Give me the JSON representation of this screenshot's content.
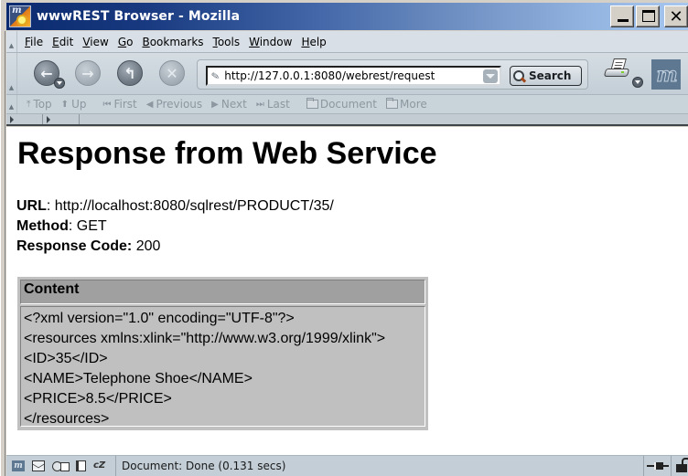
{
  "window": {
    "title": "wwwREST Browser - Mozilla",
    "controls": {
      "minimize": "minimize",
      "maximize": "maximize",
      "close": "close"
    }
  },
  "menubar": {
    "items": [
      {
        "label": "File",
        "accel": "F"
      },
      {
        "label": "Edit",
        "accel": "E"
      },
      {
        "label": "View",
        "accel": "V"
      },
      {
        "label": "Go",
        "accel": "G"
      },
      {
        "label": "Bookmarks",
        "accel": "B"
      },
      {
        "label": "Tools",
        "accel": "T"
      },
      {
        "label": "Window",
        "accel": "W"
      },
      {
        "label": "Help",
        "accel": "H"
      }
    ]
  },
  "navbar": {
    "back_icon": "back-arrow-icon",
    "forward_icon": "forward-arrow-icon",
    "reload_icon": "reload-icon",
    "stop_icon": "stop-icon",
    "url": "http://127.0.0.1:8080/webrest/request",
    "search_label": "Search",
    "print_icon": "printer-icon",
    "throbber_icon": "mozilla-m-logo"
  },
  "sitenav": {
    "items": [
      {
        "label": "Top",
        "icon": "⤒"
      },
      {
        "label": "Up",
        "icon": "⬆"
      },
      {
        "label": "First",
        "icon": "⏮"
      },
      {
        "label": "Previous",
        "icon": "◀"
      },
      {
        "label": "Next",
        "icon": "▶"
      },
      {
        "label": "Last",
        "icon": "⏭"
      },
      {
        "label": "Document",
        "icon": "folder"
      },
      {
        "label": "More",
        "icon": "folder"
      }
    ]
  },
  "page": {
    "title": "Response from Web Service",
    "url_label": "URL",
    "url_value": ": http://localhost:8080/sqlrest/PRODUCT/35/",
    "method_label": "Method",
    "method_value": ": GET",
    "response_code_label": "Response Code:",
    "response_code_value": " 200",
    "content_header": "Content",
    "content_lines": [
      "<?xml version=\"1.0\" encoding=\"UTF-8\"?>",
      "<resources xmlns:xlink=\"http://www.w3.org/1999/xlink\">",
      "<ID>35</ID>",
      "<NAME>Telephone Shoe</NAME>",
      "<PRICE>8.5</PRICE>",
      "</resources>"
    ]
  },
  "statusbar": {
    "status_text": "Document: Done (0.131 secs)",
    "icons": [
      "navigator-icon",
      "mail-icon",
      "chat-icon",
      "composer-icon",
      "address-book-icon"
    ],
    "cz_label": "cZ"
  },
  "colors": {
    "titlebar_start": "#0b2a6f",
    "titlebar_end": "#a7c7ef",
    "content_box_bg": "#c0c0c0",
    "content_header_bg": "#a0a0a0",
    "chrome_bg": "#c9d3da"
  }
}
